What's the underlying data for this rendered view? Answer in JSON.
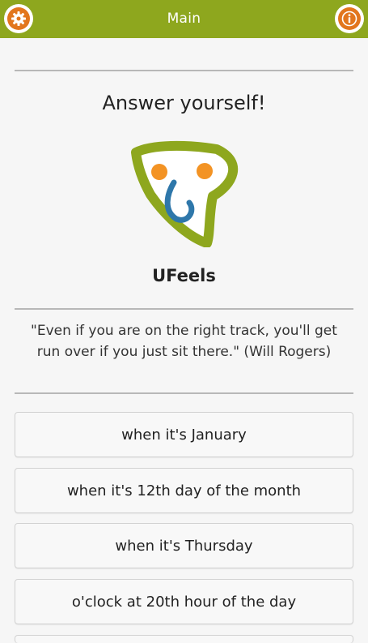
{
  "header": {
    "title": "Main",
    "bar_color": "#8ea71e",
    "settings_icon": "gear-icon",
    "info_icon": "info-icon"
  },
  "main": {
    "heading": "Answer yourself!",
    "logo_icon": "heart-face-logo",
    "app_name": "UFeels",
    "quote": "\"Even if you are on the right track, you'll get run over if you just sit there.\" (Will Rogers)",
    "options": [
      {
        "label": "when it's January"
      },
      {
        "label": "when it's 12th day of the month"
      },
      {
        "label": "when it's Thursday"
      },
      {
        "label": "o'clock at 20th hour of the day"
      }
    ]
  }
}
